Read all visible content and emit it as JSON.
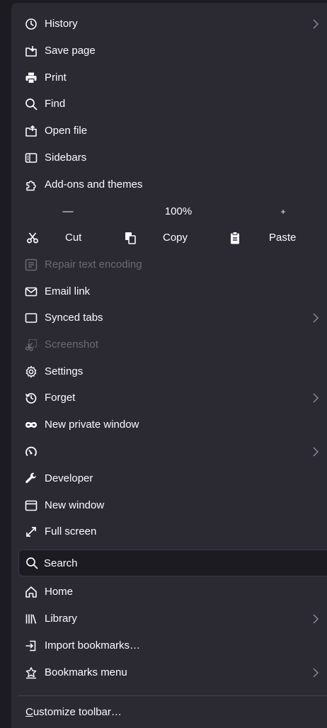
{
  "menu": {
    "items": [
      {
        "key": "history",
        "label": "History",
        "icon": "clock-icon",
        "submenu": true
      },
      {
        "key": "save_page",
        "label": "Save page",
        "icon": "save-page-icon"
      },
      {
        "key": "print",
        "label": "Print",
        "icon": "printer-icon"
      },
      {
        "key": "find",
        "label": "Find",
        "icon": "search-icon"
      },
      {
        "key": "open_file",
        "label": "Open file",
        "icon": "open-file-icon"
      },
      {
        "key": "sidebars",
        "label": "Sidebars",
        "icon": "sidebar-icon"
      },
      {
        "key": "addons",
        "label": "Add-ons and themes",
        "icon": "puzzle-icon"
      }
    ],
    "zoom": {
      "minus": "—",
      "value": "100%",
      "plus": "+"
    },
    "edit": {
      "cut": "Cut",
      "copy": "Copy",
      "paste": "Paste"
    },
    "items2": [
      {
        "key": "repair_text_encoding",
        "label": "Repair text encoding",
        "icon": "text-encoding-icon",
        "disabled": true
      },
      {
        "key": "email_link",
        "label": "Email link",
        "icon": "mail-icon"
      },
      {
        "key": "synced_tabs",
        "label": "Synced tabs",
        "icon": "synced-tabs-icon",
        "submenu": true
      },
      {
        "key": "screenshot",
        "label": "Screenshot",
        "icon": "screenshot-icon",
        "disabled": true
      },
      {
        "key": "settings",
        "label": "Settings",
        "icon": "gear-icon"
      },
      {
        "key": "forget",
        "label": "Forget",
        "icon": "forget-icon",
        "submenu": true
      },
      {
        "key": "new_private_window",
        "label": "New private window",
        "icon": "private-mask-icon"
      },
      {
        "key": "performance",
        "label": "",
        "icon": "gauge-icon",
        "submenu": true
      },
      {
        "key": "developer",
        "label": "Developer",
        "icon": "wrench-icon"
      },
      {
        "key": "new_window",
        "label": "New window",
        "icon": "new-window-icon"
      },
      {
        "key": "full_screen",
        "label": "Full screen",
        "icon": "fullscreen-icon"
      }
    ],
    "search": {
      "label": "Search",
      "icon": "search-icon"
    },
    "items3": [
      {
        "key": "home",
        "label": "Home",
        "icon": "home-icon"
      },
      {
        "key": "library",
        "label": "Library",
        "icon": "library-icon",
        "submenu": true
      },
      {
        "key": "import_bookmarks",
        "label": "Import bookmarks…",
        "icon": "import-icon"
      },
      {
        "key": "bookmarks_menu",
        "label": "Bookmarks menu",
        "icon": "bookmark-star-icon",
        "submenu": true
      }
    ],
    "customize": {
      "accesskey": "C",
      "rest": "ustomize toolbar…"
    }
  },
  "colors": {
    "panel": "#2b2a33",
    "background": "#1c1b22",
    "text": "#fbfbfe",
    "disabled_text": "#6b6a72",
    "chevron": "#8f8f9d"
  }
}
